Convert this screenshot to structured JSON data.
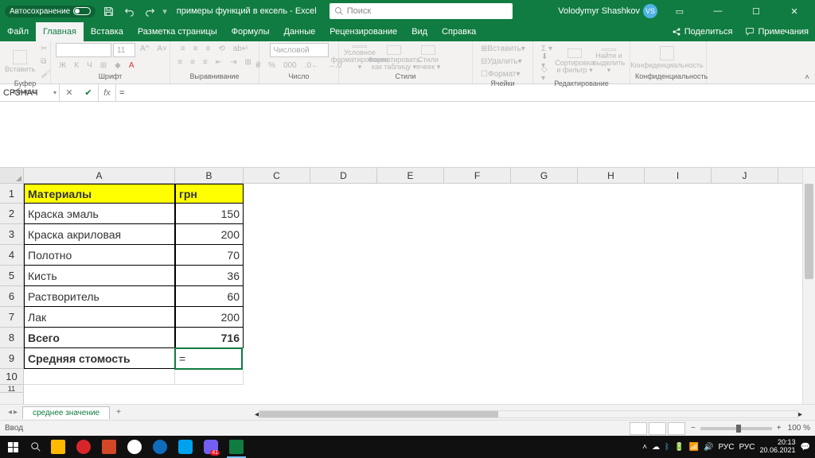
{
  "titlebar": {
    "autosave_label": "Автосохранение",
    "filename": "примеры функций в ексель",
    "app": "Excel",
    "search_placeholder": "Поиск",
    "user_name": "Volodymyr Shashkov",
    "user_initials": "VS"
  },
  "menutabs": {
    "file": "Файл",
    "tabs": [
      "Главная",
      "Вставка",
      "Разметка страницы",
      "Формулы",
      "Данные",
      "Рецензирование",
      "Вид",
      "Справка"
    ],
    "share": "Поделиться",
    "comments": "Примечания"
  },
  "ribbon": {
    "clipboard": {
      "label": "Буфер обмена",
      "paste": "Вставить"
    },
    "font": {
      "label": "Шрифт",
      "size": "11"
    },
    "align": {
      "label": "Выравнивание"
    },
    "number": {
      "label": "Число",
      "format": "Числовой"
    },
    "styles": {
      "label": "Стили",
      "cond": "Условное",
      "cond2": "форматирование",
      "table": "Форматировать",
      "table2": "как таблицу",
      "cell": "Стили",
      "cell2": "ячеек"
    },
    "cells": {
      "label": "Ячейки",
      "insert": "Вставить",
      "delete": "Удалить",
      "format": "Формат"
    },
    "editing": {
      "label": "Редактирование",
      "sort": "Сортировка",
      "sort2": "и фильтр",
      "find": "Найти и",
      "find2": "выделить"
    },
    "sens": {
      "label": "Конфиденциальность",
      "btn": "Конфиденциальность"
    }
  },
  "formulabar": {
    "namebox": "СРЗНАЧ",
    "formula": "="
  },
  "columns": [
    "A",
    "B",
    "C",
    "D",
    "E",
    "F",
    "G",
    "H",
    "I",
    "J"
  ],
  "table": {
    "hdr_a": "Материалы",
    "hdr_b": "грн",
    "rows": [
      {
        "a": "Краска эмаль",
        "b": "150"
      },
      {
        "a": "Краска акриловая",
        "b": "200"
      },
      {
        "a": "Полотно",
        "b": "70"
      },
      {
        "a": "Кисть",
        "b": "36"
      },
      {
        "a": "Растворитель",
        "b": "60"
      },
      {
        "a": "Лак",
        "b": "200"
      }
    ],
    "total_label": "Всего",
    "total_value": "716",
    "avg_label": "Средняя стомость",
    "avg_value": "="
  },
  "sheetbar": {
    "sheet": "среднее значение",
    "add": "+"
  },
  "statusbar": {
    "mode": "Ввод",
    "zoom": "100 %"
  },
  "taskbar": {
    "lang1": "РУС",
    "lang2": "РУС",
    "time": "20:13",
    "date": "20.06.2021"
  }
}
